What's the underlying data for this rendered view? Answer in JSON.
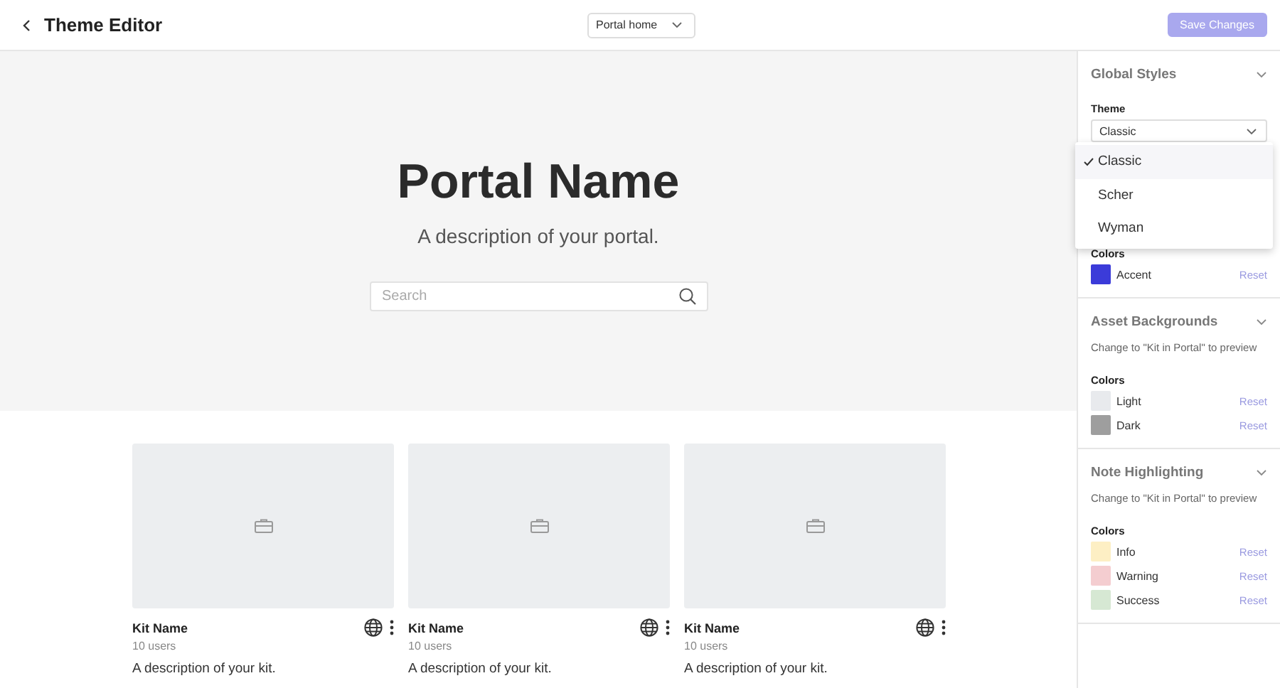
{
  "header": {
    "title": "Theme Editor",
    "page_select": "Portal home",
    "save_button": {
      "label": "Save Changes",
      "disabled": true
    }
  },
  "hero": {
    "title": "Portal Name",
    "description": "A description of your portal.",
    "search": {
      "placeholder": "Search"
    }
  },
  "kits": [
    {
      "name": "Kit Name",
      "users": "10 users",
      "description": "A description of your kit."
    },
    {
      "name": "Kit Name",
      "users": "10 users",
      "description": "A description of your kit."
    },
    {
      "name": "Kit Name",
      "users": "10 users",
      "description": "A description of your kit."
    }
  ],
  "sidebar": {
    "sections": [
      {
        "title": "Global Styles",
        "expanded": true,
        "theme": {
          "label": "Theme",
          "value": "Classic",
          "options": [
            {
              "label": "Classic",
              "selected": true
            },
            {
              "label": "Scher",
              "selected": false
            },
            {
              "label": "Wyman",
              "selected": false
            }
          ]
        },
        "colors_label": "Colors",
        "colors": [
          {
            "name": "Accent",
            "color": "#3b3bd9",
            "reset": "Reset"
          }
        ]
      },
      {
        "title": "Asset Backgrounds",
        "expanded": true,
        "note": "Change to \"Kit in Portal\" to preview",
        "colors_label": "Colors",
        "colors": [
          {
            "name": "Light",
            "color": "#e8eaed",
            "reset": "Reset"
          },
          {
            "name": "Dark",
            "color": "#9e9e9e",
            "reset": "Reset"
          }
        ]
      },
      {
        "title": "Note Highlighting",
        "expanded": true,
        "note": "Change to \"Kit in Portal\" to preview",
        "colors_label": "Colors",
        "colors": [
          {
            "name": "Info",
            "color": "#fdefc4",
            "reset": "Reset"
          },
          {
            "name": "Warning",
            "color": "#f4cdd0",
            "reset": "Reset"
          },
          {
            "name": "Success",
            "color": "#d6e8d3",
            "reset": "Reset"
          }
        ]
      }
    ]
  }
}
